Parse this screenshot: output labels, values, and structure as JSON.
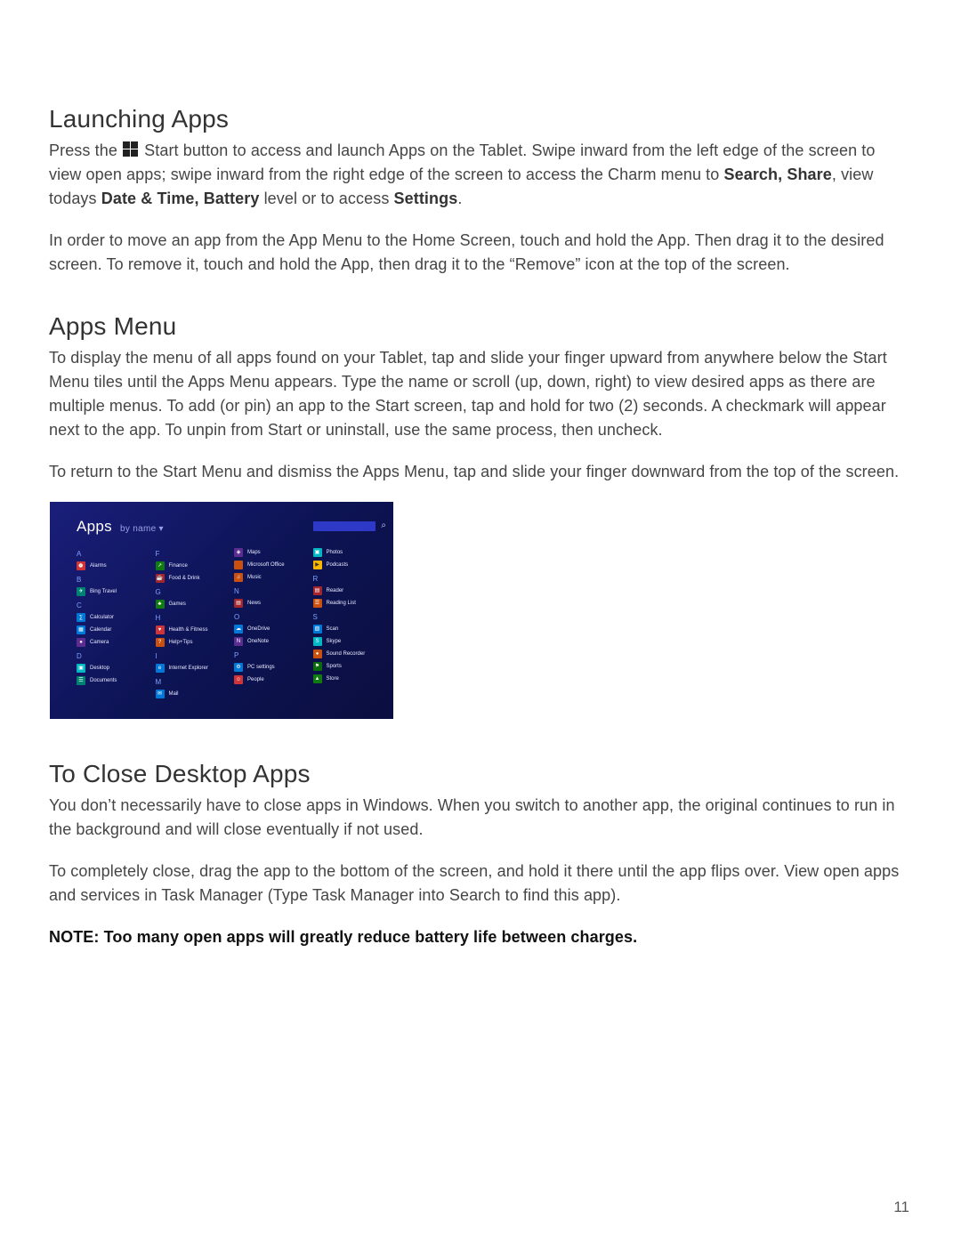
{
  "page_number": "11",
  "sections": {
    "launching": {
      "heading": "Launching Apps",
      "para1_pre": "Press the ",
      "para1_mid": " Start button to access and launch Apps on the Tablet. Swipe inward from the left edge of the screen to view open apps; swipe inward from the right edge of the screen to access the Charm menu to ",
      "para1_bold1": "Search, Share",
      "para1_mid2": ", view todays ",
      "para1_bold2": "Date & Time, Battery",
      "para1_mid3": " level or to access ",
      "para1_bold3": "Settings",
      "para1_end": ".",
      "para2": "In order to move an app from the App Menu to the Home Screen, touch and hold the App. Then drag it to the desired screen. To remove it, touch and hold the App, then drag it to the “Remove” icon at the top of the screen."
    },
    "appsmenu": {
      "heading": "Apps Menu",
      "para1": "To display the menu of all apps found on your Tablet, tap and slide your finger upward from anywhere below the Start Menu tiles until the Apps Menu appears. Type the name or scroll (up, down, right) to view desired apps as there are multiple menus. To add (or pin) an app to the Start screen, tap and hold for two (2) seconds. A checkmark will appear next to the app. To unpin from Start or uninstall, use the same process, then uncheck.",
      "para2": "To return to the Start Menu and dismiss the Apps Menu, tap and slide your finger downward from the top of the screen."
    },
    "close": {
      "heading": "To Close Desktop Apps",
      "para1": "You don’t necessarily have to close apps in Windows. When you switch to another app, the original continues to run in the background and will close eventually if not used.",
      "para2": "To completely close, drag the app to the bottom of the screen, and hold it there until the app flips over. View open apps and services in Task Manager (Type Task Manager into Search to find this app).",
      "note": "NOTE: Too many open apps will greatly reduce battery life between charges."
    }
  },
  "apps_screenshot": {
    "title": "Apps",
    "sort_label": "by name",
    "columns": [
      {
        "groups": [
          {
            "letter": "A",
            "items": [
              {
                "name": "Alarms",
                "color": "red",
                "glyph": "⏰"
              }
            ]
          },
          {
            "letter": "B",
            "items": [
              {
                "name": "Bing Travel",
                "color": "teal",
                "glyph": "✈"
              }
            ]
          },
          {
            "letter": "C",
            "items": [
              {
                "name": "Calculator",
                "color": "blue",
                "glyph": "∑"
              },
              {
                "name": "Calendar",
                "color": "blue",
                "glyph": "▦"
              },
              {
                "name": "Camera",
                "color": "purple",
                "glyph": "●"
              }
            ]
          },
          {
            "letter": "D",
            "items": [
              {
                "name": "Desktop",
                "color": "cyan",
                "glyph": "▣"
              },
              {
                "name": "Documents",
                "color": "teal",
                "glyph": "☰"
              }
            ]
          }
        ]
      },
      {
        "groups": [
          {
            "letter": "F",
            "items": [
              {
                "name": "Finance",
                "color": "green",
                "glyph": "↗"
              },
              {
                "name": "Food & Drink",
                "color": "dred",
                "glyph": "☕"
              }
            ]
          },
          {
            "letter": "G",
            "items": [
              {
                "name": "Games",
                "color": "green",
                "glyph": "♣"
              }
            ]
          },
          {
            "letter": "H",
            "items": [
              {
                "name": "Health & Fitness",
                "color": "red",
                "glyph": "♥"
              },
              {
                "name": "Help+Tips",
                "color": "orange",
                "glyph": "?"
              }
            ]
          },
          {
            "letter": "I",
            "items": [
              {
                "name": "Internet Explorer",
                "color": "blue",
                "glyph": "e"
              }
            ]
          },
          {
            "letter": "M",
            "items": [
              {
                "name": "Mail",
                "color": "blue",
                "glyph": "✉"
              }
            ]
          }
        ]
      },
      {
        "groups": [
          {
            "letter": "",
            "items": [
              {
                "name": "Maps",
                "color": "purple",
                "glyph": "◈"
              },
              {
                "name": "Microsoft Office",
                "color": "orange",
                "glyph": ""
              },
              {
                "name": "Music",
                "color": "orange",
                "glyph": "♫"
              }
            ]
          },
          {
            "letter": "N",
            "items": [
              {
                "name": "News",
                "color": "dred",
                "glyph": "▤"
              }
            ]
          },
          {
            "letter": "O",
            "items": [
              {
                "name": "OneDrive",
                "color": "blue",
                "glyph": "☁"
              },
              {
                "name": "OneNote",
                "color": "purple",
                "glyph": "N"
              }
            ]
          },
          {
            "letter": "P",
            "items": [
              {
                "name": "PC settings",
                "color": "blue",
                "glyph": "⚙"
              },
              {
                "name": "People",
                "color": "red",
                "glyph": "☺"
              }
            ]
          }
        ]
      },
      {
        "groups": [
          {
            "letter": "",
            "items": [
              {
                "name": "Photos",
                "color": "cyan",
                "glyph": "▣"
              },
              {
                "name": "Podcasts",
                "color": "yellow",
                "glyph": "▶"
              }
            ]
          },
          {
            "letter": "R",
            "items": [
              {
                "name": "Reader",
                "color": "dred",
                "glyph": "▤"
              },
              {
                "name": "Reading List",
                "color": "orange",
                "glyph": "☰"
              }
            ]
          },
          {
            "letter": "S",
            "items": [
              {
                "name": "Scan",
                "color": "blue",
                "glyph": "▧"
              },
              {
                "name": "Skype",
                "color": "cyan",
                "glyph": "S"
              },
              {
                "name": "Sound Recorder",
                "color": "orange",
                "glyph": "●"
              },
              {
                "name": "Sports",
                "color": "dgreen",
                "glyph": "⚑"
              },
              {
                "name": "Store",
                "color": "green",
                "glyph": "▲"
              }
            ]
          }
        ]
      }
    ]
  }
}
